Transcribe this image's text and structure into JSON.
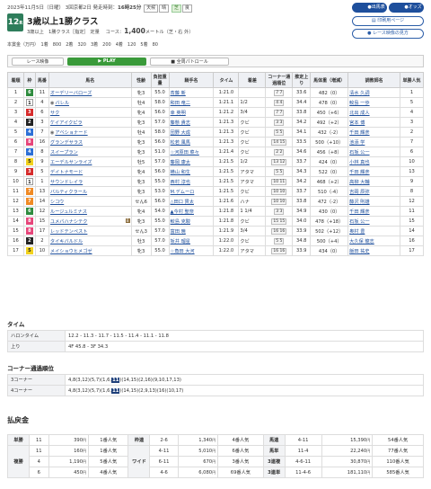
{
  "header": {
    "date": "2023年11月5日（日曜）",
    "meeting": "3回京都2日",
    "post_label": "発走時刻：",
    "post_time": "16時25分",
    "weather_label": "天候",
    "weather": "晴",
    "track_type": "芝",
    "going": "良"
  },
  "race": {
    "number": "12",
    "number_suffix": "R",
    "name": "3歳以上1勝クラス",
    "class_text": "3歳以上　1勝クラス［指定］ 定量",
    "course_label": "コース：",
    "distance": "1,400",
    "course_unit": "メートル（芝・右 外）",
    "prize_label": "本賞金（万円）",
    "prizes": "1着　800　2着　320　3着　200　4着　120　5着　80"
  },
  "buttons": {
    "horse_table": "出馬表",
    "odds": "オッズ",
    "print": "印刷用ページ",
    "watch_race": "レース映像の見方"
  },
  "video_bar": {
    "label": "レース映像",
    "play": "▶ PLAY",
    "patrol": "全周パトロール"
  },
  "table_headers": [
    "着順",
    "枠",
    "馬番",
    "馬名",
    "性齢",
    "負担重量",
    "騎手名",
    "タイム",
    "着差",
    "コーナー通過順位",
    "推定上り",
    "馬体重（増減）",
    "調教師名",
    "単勝人気"
  ],
  "results": [
    {
      "rank": "1",
      "frame": "6",
      "frame_color": "#2e8b3e",
      "num": "11",
      "horse": "オーデリーバローズ",
      "sex_age": "牝3",
      "weight": "55.0",
      "jockey": "斎藤 新",
      "time": "1:21.0",
      "margin": "",
      "corner": "7 7",
      "last": "33.6",
      "bw": "482（0）",
      "trainer": "清水 久詞",
      "pop": "1"
    },
    {
      "rank": "2",
      "frame": "1",
      "frame_color": "#ffffff",
      "num": "4",
      "horse": "バレル",
      "sex_age": "牡4",
      "weight": "58.0",
      "jockey": "和田 竜二",
      "time": "1:21.1",
      "margin": "1/2",
      "corner": "4 4",
      "last": "34.4",
      "bw": "478（0）",
      "trainer": "鮫島 一歩",
      "pop": "5"
    },
    {
      "rank": "3",
      "frame": "3",
      "frame_color": "#d62b2b",
      "num": "6",
      "horse": "サク",
      "sex_age": "牝4",
      "weight": "56.0",
      "jockey": "幸 英明",
      "time": "1:21.2",
      "margin": "3/4",
      "corner": "7 7",
      "last": "33.8",
      "bw": "450（+6）",
      "trainer": "北出 成人",
      "pop": "4"
    },
    {
      "rank": "4",
      "frame": "2",
      "frame_color": "#222222",
      "num": "3",
      "horse": "ケイアイクピラ",
      "sex_age": "牝3",
      "weight": "57.0",
      "jockey": "藤懸 貴志",
      "time": "1:21.3",
      "margin": "クビ",
      "corner": "3 3",
      "last": "34.2",
      "bw": "492（+2）",
      "trainer": "宮本 博",
      "pop": "3"
    },
    {
      "rank": "5",
      "frame": "4",
      "frame_color": "#2c6fd6",
      "num": "7",
      "horse": "アベショナード",
      "sex_age": "牡4",
      "weight": "58.0",
      "jockey": "団野 大成",
      "time": "1:21.3",
      "margin": "クビ",
      "corner": "5 5",
      "last": "34.1",
      "bw": "432（-2）",
      "trainer": "千田 輝彦",
      "pop": "2"
    },
    {
      "rank": "6",
      "frame": "8",
      "frame_color": "#e6457a",
      "num": "16",
      "horse": "グランデサラス",
      "sex_age": "牝3",
      "weight": "56.0",
      "jockey": "松若 風馬",
      "time": "1:21.3",
      "margin": "クビ",
      "corner": "14 15",
      "last": "33.5",
      "bw": "500（+10）",
      "trainer": "池添 学",
      "pop": "7"
    },
    {
      "rank": "7",
      "frame": "4",
      "frame_color": "#2c6fd6",
      "num": "8",
      "horse": "スイープラン",
      "sex_age": "牝3",
      "weight": "51.0",
      "jockey": "☆河原田 菜々",
      "time": "1:21.4",
      "margin": "クビ",
      "corner": "2 2",
      "last": "34.6",
      "bw": "456（+8）",
      "trainer": "石坂 公一",
      "pop": "6"
    },
    {
      "rank": "8",
      "frame": "5",
      "frame_color": "#f2d21e",
      "num": "9",
      "horse": "エーデルサンライズ",
      "sex_age": "牡5",
      "weight": "57.0",
      "jockey": "藤岡 康太",
      "time": "1:21.5",
      "margin": "1/2",
      "corner": "13 12",
      "last": "33.7",
      "bw": "424（0）",
      "trainer": "小林 真也",
      "pop": "10"
    },
    {
      "rank": "9",
      "frame": "3",
      "frame_color": "#d62b2b",
      "num": "5",
      "horse": "デイトナモード",
      "sex_age": "牝4",
      "weight": "56.0",
      "jockey": "横山 和生",
      "time": "1:21.5",
      "margin": "アタマ",
      "corner": "5 5",
      "last": "34.3",
      "bw": "522（0）",
      "trainer": "千田 輝彦",
      "pop": "13"
    },
    {
      "rank": "10",
      "frame": "1",
      "frame_color": "#ffffff",
      "num": "1",
      "horse": "サウンドレイラ",
      "sex_age": "牝3",
      "weight": "55.0",
      "jockey": "西村 淳也",
      "time": "1:21.5",
      "margin": "アタマ",
      "corner": "10 11",
      "last": "34.2",
      "bw": "468（+2）",
      "trainer": "高柳 大輔",
      "pop": "9"
    },
    {
      "rank": "11",
      "frame": "7",
      "frame_color": "#f08a24",
      "num": "13",
      "horse": "バルティクラール",
      "sex_age": "牝3",
      "weight": "53.0",
      "jockey": "M.デムーロ",
      "time": "1:21.5",
      "margin": "クビ",
      "corner": "10 10",
      "last": "33.7",
      "bw": "510（-4）",
      "trainer": "吉岡 辰弥",
      "pop": "8"
    },
    {
      "rank": "12",
      "frame": "7",
      "frame_color": "#f08a24",
      "num": "14",
      "horse": "シコウ",
      "sex_age": "セん6",
      "weight": "56.0",
      "jockey": "△田口 貫太",
      "time": "1:21.6",
      "margin": "ハナ",
      "corner": "10 10",
      "last": "33.8",
      "bw": "472（-2）",
      "trainer": "藤沢 則雄",
      "pop": "12"
    },
    {
      "rank": "13",
      "frame": "6",
      "frame_color": "#2e8b3e",
      "num": "12",
      "horse": "ルージュルミナス",
      "sex_age": "牝4",
      "weight": "54.0",
      "jockey": "▲今村 聖奈",
      "time": "1:21.8",
      "margin": "1 1/4",
      "corner": "3 3",
      "last": "34.9",
      "bw": "430（0）",
      "trainer": "千田 輝彦",
      "pop": "11"
    },
    {
      "rank": "14",
      "frame": "8",
      "frame_color": "#e6457a",
      "num": "15",
      "horse": "ユメバハナシテク",
      "sex_age": "牝3",
      "weight": "55.0",
      "jockey": "鮫島 克駿",
      "time": "1:21.8",
      "margin": "クビ",
      "corner": "15 15",
      "last": "34.0",
      "bw": "478（+18）",
      "trainer": "石坂 公一",
      "pop": "15"
    },
    {
      "rank": "15",
      "frame": "8",
      "frame_color": "#e6457a",
      "num": "17",
      "horse": "レッドテンペスト",
      "sex_age": "セん3",
      "weight": "57.0",
      "jockey": "富田 暁",
      "time": "1:21.9",
      "margin": "3/4",
      "corner": "16 16",
      "last": "33.9",
      "bw": "502（+12）",
      "trainer": "奥村 豊",
      "pop": "14"
    },
    {
      "rank": "16",
      "frame": "2",
      "frame_color": "#222222",
      "num": "2",
      "horse": "タイキバルドル",
      "sex_age": "牡3",
      "weight": "57.0",
      "jockey": "坂井 瑠星",
      "time": "1:22.0",
      "margin": "クビ",
      "corner": "5 5",
      "last": "34.8",
      "bw": "500（+4）",
      "trainer": "大久保 龍志",
      "pop": "16"
    },
    {
      "rank": "17",
      "frame": "5",
      "frame_color": "#f2d21e",
      "num": "10",
      "horse": "メイショウヒメゴゼ",
      "sex_age": "牝3",
      "weight": "55.0",
      "jockey": "☆角田 大河",
      "time": "1:22.0",
      "margin": "アタマ",
      "corner": "16 16",
      "last": "33.9",
      "bw": "434（0）",
      "trainer": "飯田 祐史",
      "pop": "17"
    }
  ],
  "blinker_mark": "B",
  "time_section": {
    "title": "タイム",
    "halon_label": "ハロンタイム",
    "halon": "12.2 - 11.3 - 11.7 - 11.5 - 11.4 - 11.1 - 11.8",
    "agari_label": "上り",
    "agari": "4F 45.8 - 3F 34.3"
  },
  "corner_section": {
    "title": "コーナー通過順位",
    "c3_label": "3コーナー",
    "c3_pre": "4,8(3,12)(5,7)(1,6,",
    "c3_hl": "11",
    "c3_post": ")(14,15)(2,16)(9,10,17,13)",
    "c4_label": "4コーナー",
    "c4_pre": "4,8(3,12)(5,7)(1,6,",
    "c4_hl": "11",
    "c4_post": ")(14,15)(2,9,13)(16)(10,17)"
  },
  "payout": {
    "title": "払戻金",
    "tansho": {
      "label": "単勝",
      "num": "11",
      "amount": "390",
      "pop": "1番人気"
    },
    "fukusho_label": "複勝",
    "fukusho": [
      {
        "num": "11",
        "amount": "160",
        "pop": "1番人気"
      },
      {
        "num": "4",
        "amount": "1,190",
        "pop": "5番人気"
      },
      {
        "num": "6",
        "amount": "450",
        "pop": "4番人気"
      }
    ],
    "wakuren": {
      "label": "枠連",
      "num": "2-6",
      "amount": "1,340",
      "pop": "4番人気"
    },
    "wide_label": "ワイド",
    "wide": [
      {
        "num": "4-11",
        "amount": "5,010",
        "pop": "6番人気"
      },
      {
        "num": "6-11",
        "amount": "670",
        "pop": "3番人気"
      },
      {
        "num": "4-6",
        "amount": "6,080",
        "pop": "69番人気"
      }
    ],
    "umaren": {
      "label": "馬連",
      "num": "4-11",
      "amount": "15,390",
      "pop": "54番人気"
    },
    "umatan": {
      "label": "馬単",
      "num": "11-4",
      "amount": "22,240",
      "pop": "77番人気"
    },
    "sanrenpuku": {
      "label": "3連複",
      "num": "4-6-11",
      "amount": "30,870",
      "pop": "110番人気"
    },
    "sanrentan": {
      "label": "3連単",
      "num": "11-4-6",
      "amount": "181,110",
      "pop": "585番人気"
    },
    "yen": "円"
  }
}
